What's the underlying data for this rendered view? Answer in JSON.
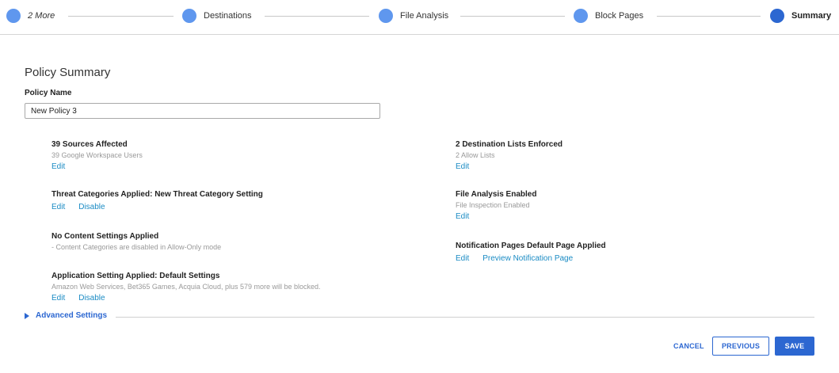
{
  "stepper": {
    "steps": [
      {
        "label": "2 More",
        "state": "completed"
      },
      {
        "label": "Destinations",
        "state": "completed"
      },
      {
        "label": "File Analysis",
        "state": "completed"
      },
      {
        "label": "Block Pages",
        "state": "completed"
      },
      {
        "label": "Summary",
        "state": "current"
      }
    ]
  },
  "page": {
    "title": "Policy Summary",
    "policy_name_label": "Policy Name",
    "policy_name_value": "New Policy 3"
  },
  "summary": {
    "sources": {
      "heading": "39 Sources Affected",
      "detail": "39 Google Workspace Users",
      "edit": "Edit"
    },
    "threat": {
      "heading": "Threat Categories Applied: New Threat Category Setting",
      "edit": "Edit",
      "disable": "Disable"
    },
    "content": {
      "heading": "No Content Settings Applied",
      "detail": "- Content Categories are disabled in Allow-Only mode"
    },
    "application": {
      "heading": "Application Setting Applied: Default Settings",
      "detail": "Amazon Web Services, Bet365 Games, Acquia Cloud, plus 579 more will be blocked.",
      "edit": "Edit",
      "disable": "Disable"
    },
    "destinations": {
      "heading": "2 Destination Lists Enforced",
      "detail": "2 Allow Lists",
      "edit": "Edit"
    },
    "file_analysis": {
      "heading": "File Analysis Enabled",
      "detail": "File Inspection Enabled",
      "edit": "Edit"
    },
    "notification": {
      "heading": "Notification Pages Default Page Applied",
      "edit": "Edit",
      "preview": "Preview Notification Page"
    }
  },
  "advanced": {
    "label": "Advanced Settings",
    "icon": "caret-right-icon",
    "expanded": false
  },
  "footer": {
    "cancel": "CANCEL",
    "previous": "PREVIOUS",
    "save": "SAVE"
  },
  "colors": {
    "step_dot": "#5f97ee",
    "step_dot_current": "#2c67d1",
    "link": "#1a8bc4",
    "primary": "#2c67d1"
  }
}
